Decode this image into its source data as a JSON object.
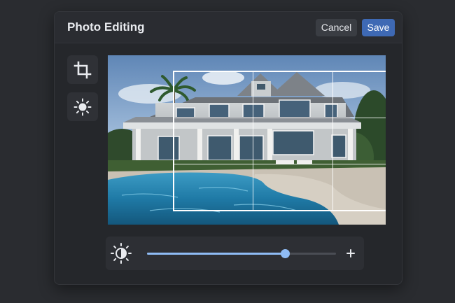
{
  "dialog": {
    "title": "Photo Editing",
    "cancel_label": "Cancel",
    "save_label": "Save"
  },
  "tools": [
    {
      "name": "crop",
      "icon": "crop-icon",
      "active": true
    },
    {
      "name": "brightness",
      "icon": "sun-icon",
      "active": false
    }
  ],
  "image": {
    "subject": "house-with-pool"
  },
  "adjustment": {
    "icon": "brightness-contrast-icon",
    "level": 0.73,
    "increase_icon": "plus-icon"
  },
  "colors": {
    "accent": "#8fbcf5",
    "save": "#3e69b4",
    "background": "#2a2c30",
    "panel": "#25272b"
  }
}
